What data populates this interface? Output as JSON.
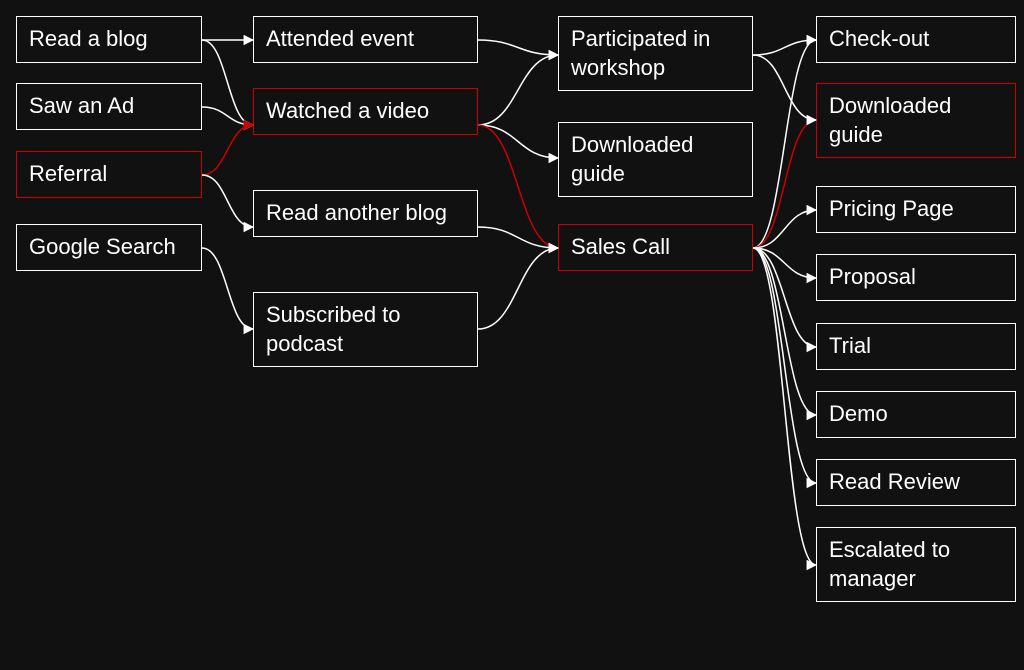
{
  "colors": {
    "bg": "#111111",
    "node_border": "#ffffff",
    "highlight": "#cc0000",
    "arrow": "#ffffff",
    "arrow_highlight": "#cc0000"
  },
  "columns": {
    "c1": [
      {
        "id": "read-blog",
        "label": "Read a blog",
        "highlight": false
      },
      {
        "id": "saw-ad",
        "label": "Saw an Ad",
        "highlight": false
      },
      {
        "id": "referral",
        "label": "Referral",
        "highlight": true
      },
      {
        "id": "google-search",
        "label": "Google Search",
        "highlight": false
      }
    ],
    "c2": [
      {
        "id": "attended-event",
        "label": "Attended event",
        "highlight": false
      },
      {
        "id": "watched-video",
        "label": "Watched a video",
        "highlight": true
      },
      {
        "id": "read-another",
        "label": "Read another blog",
        "highlight": false
      },
      {
        "id": "subscribed",
        "label": "Subscribed to podcast",
        "highlight": false
      }
    ],
    "c3": [
      {
        "id": "workshop",
        "label": "Participated in workshop",
        "highlight": false
      },
      {
        "id": "downloaded-guide",
        "label": "Downloaded guide",
        "highlight": false
      },
      {
        "id": "sales-call",
        "label": "Sales Call",
        "highlight": true
      }
    ],
    "c4": [
      {
        "id": "check-out",
        "label": "Check-out",
        "highlight": false
      },
      {
        "id": "downloaded-guide2",
        "label": "Downloaded guide",
        "highlight": true
      },
      {
        "id": "pricing-page",
        "label": "Pricing Page",
        "highlight": false
      },
      {
        "id": "proposal",
        "label": "Proposal",
        "highlight": false
      },
      {
        "id": "trial",
        "label": "Trial",
        "highlight": false
      },
      {
        "id": "demo",
        "label": "Demo",
        "highlight": false
      },
      {
        "id": "read-review",
        "label": "Read Review",
        "highlight": false
      },
      {
        "id": "escalated",
        "label": "Escalated to manager",
        "highlight": false
      }
    ]
  },
  "edges": [
    {
      "from": "read-blog",
      "to": "attended-event",
      "highlight": false
    },
    {
      "from": "read-blog",
      "to": "watched-video",
      "highlight": false
    },
    {
      "from": "saw-ad",
      "to": "watched-video",
      "highlight": false
    },
    {
      "from": "referral",
      "to": "watched-video",
      "highlight": true
    },
    {
      "from": "referral",
      "to": "read-another",
      "highlight": false
    },
    {
      "from": "google-search",
      "to": "subscribed",
      "highlight": false
    },
    {
      "from": "attended-event",
      "to": "workshop",
      "highlight": false
    },
    {
      "from": "watched-video",
      "to": "workshop",
      "highlight": false
    },
    {
      "from": "watched-video",
      "to": "downloaded-guide",
      "highlight": false
    },
    {
      "from": "watched-video",
      "to": "sales-call",
      "highlight": true
    },
    {
      "from": "read-another",
      "to": "sales-call",
      "highlight": false
    },
    {
      "from": "subscribed",
      "to": "sales-call",
      "highlight": false
    },
    {
      "from": "sales-call",
      "to": "check-out",
      "highlight": false
    },
    {
      "from": "sales-call",
      "to": "downloaded-guide2",
      "highlight": true
    },
    {
      "from": "sales-call",
      "to": "pricing-page",
      "highlight": false
    },
    {
      "from": "sales-call",
      "to": "proposal",
      "highlight": false
    },
    {
      "from": "sales-call",
      "to": "trial",
      "highlight": false
    },
    {
      "from": "sales-call",
      "to": "demo",
      "highlight": false
    },
    {
      "from": "sales-call",
      "to": "read-review",
      "highlight": false
    },
    {
      "from": "sales-call",
      "to": "escalated",
      "highlight": false
    },
    {
      "from": "workshop",
      "to": "check-out",
      "highlight": false
    },
    {
      "from": "workshop",
      "to": "downloaded-guide2",
      "highlight": false
    }
  ]
}
